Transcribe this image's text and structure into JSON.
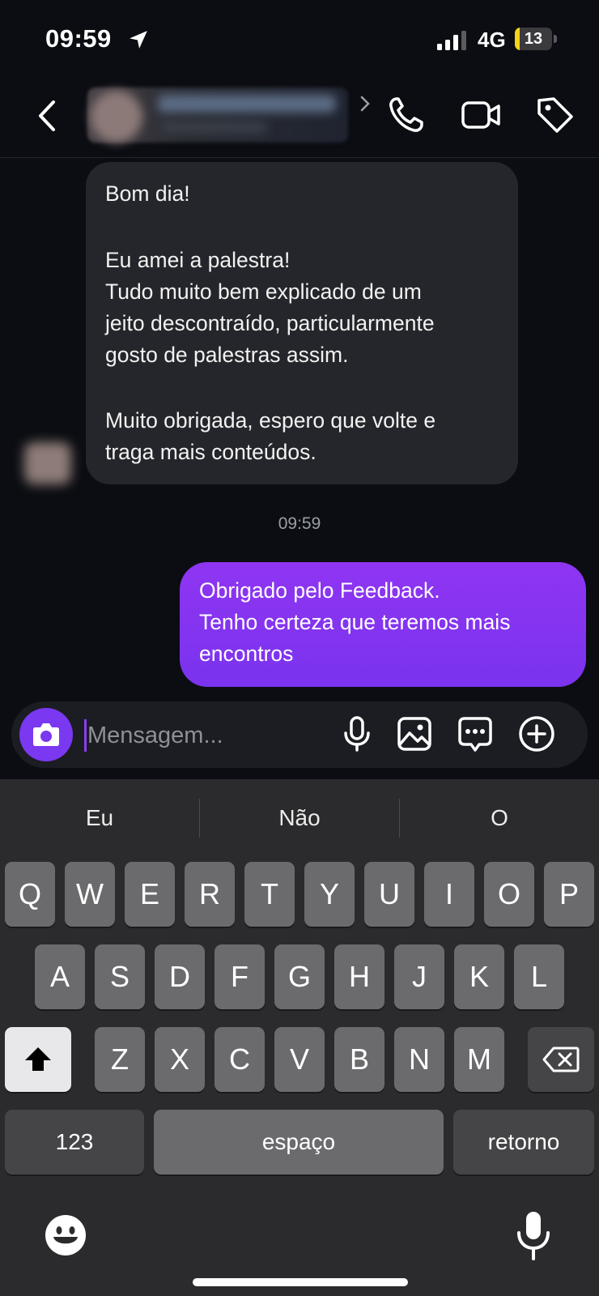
{
  "status_bar": {
    "time": "09:59",
    "network": "4G",
    "battery": "13",
    "battery_level": 0.13
  },
  "header": {
    "icons": [
      "back-icon",
      "chevron-right-icon",
      "phone-icon",
      "video-icon",
      "tag-icon"
    ]
  },
  "conversation": {
    "incoming": {
      "lines": [
        "Bom dia!",
        "Eu amei a palestra!",
        "Tudo muito bem explicado de um",
        "jeito descontraído, particularmente",
        "gosto de palestras assim.",
        "Muito obrigada, espero que volte e",
        "traga mais conteúdos."
      ]
    },
    "timestamp": "09:59",
    "outgoing": {
      "lines": [
        "Obrigado pelo Feedback.",
        "Tenho certeza que teremos mais",
        "encontros"
      ]
    }
  },
  "composer": {
    "placeholder": "Mensagem...",
    "value": "",
    "icons": [
      "camera-icon",
      "microphone-icon",
      "gallery-icon",
      "sticker-icon",
      "plus-circle-icon"
    ]
  },
  "keyboard": {
    "suggestions": [
      "Eu",
      "Não",
      "O"
    ],
    "row1": [
      "Q",
      "W",
      "E",
      "R",
      "T",
      "Y",
      "U",
      "I",
      "O",
      "P"
    ],
    "row2": [
      "A",
      "S",
      "D",
      "F",
      "G",
      "H",
      "J",
      "K",
      "L"
    ],
    "row3": [
      "Z",
      "X",
      "C",
      "V",
      "B",
      "N",
      "M"
    ],
    "numbers_label": "123",
    "space_label": "espaço",
    "return_label": "retorno",
    "icons": [
      "shift-icon",
      "backspace-icon",
      "emoji-icon",
      "dictation-mic-icon"
    ]
  },
  "colors": {
    "background": "#0b0d12",
    "incoming_bubble": "#25262b",
    "outgoing_bubble": "#8033f0",
    "accent": "#7a38f0",
    "keyboard_bg": "#2b2b2d",
    "key": "#6b6b6e"
  }
}
